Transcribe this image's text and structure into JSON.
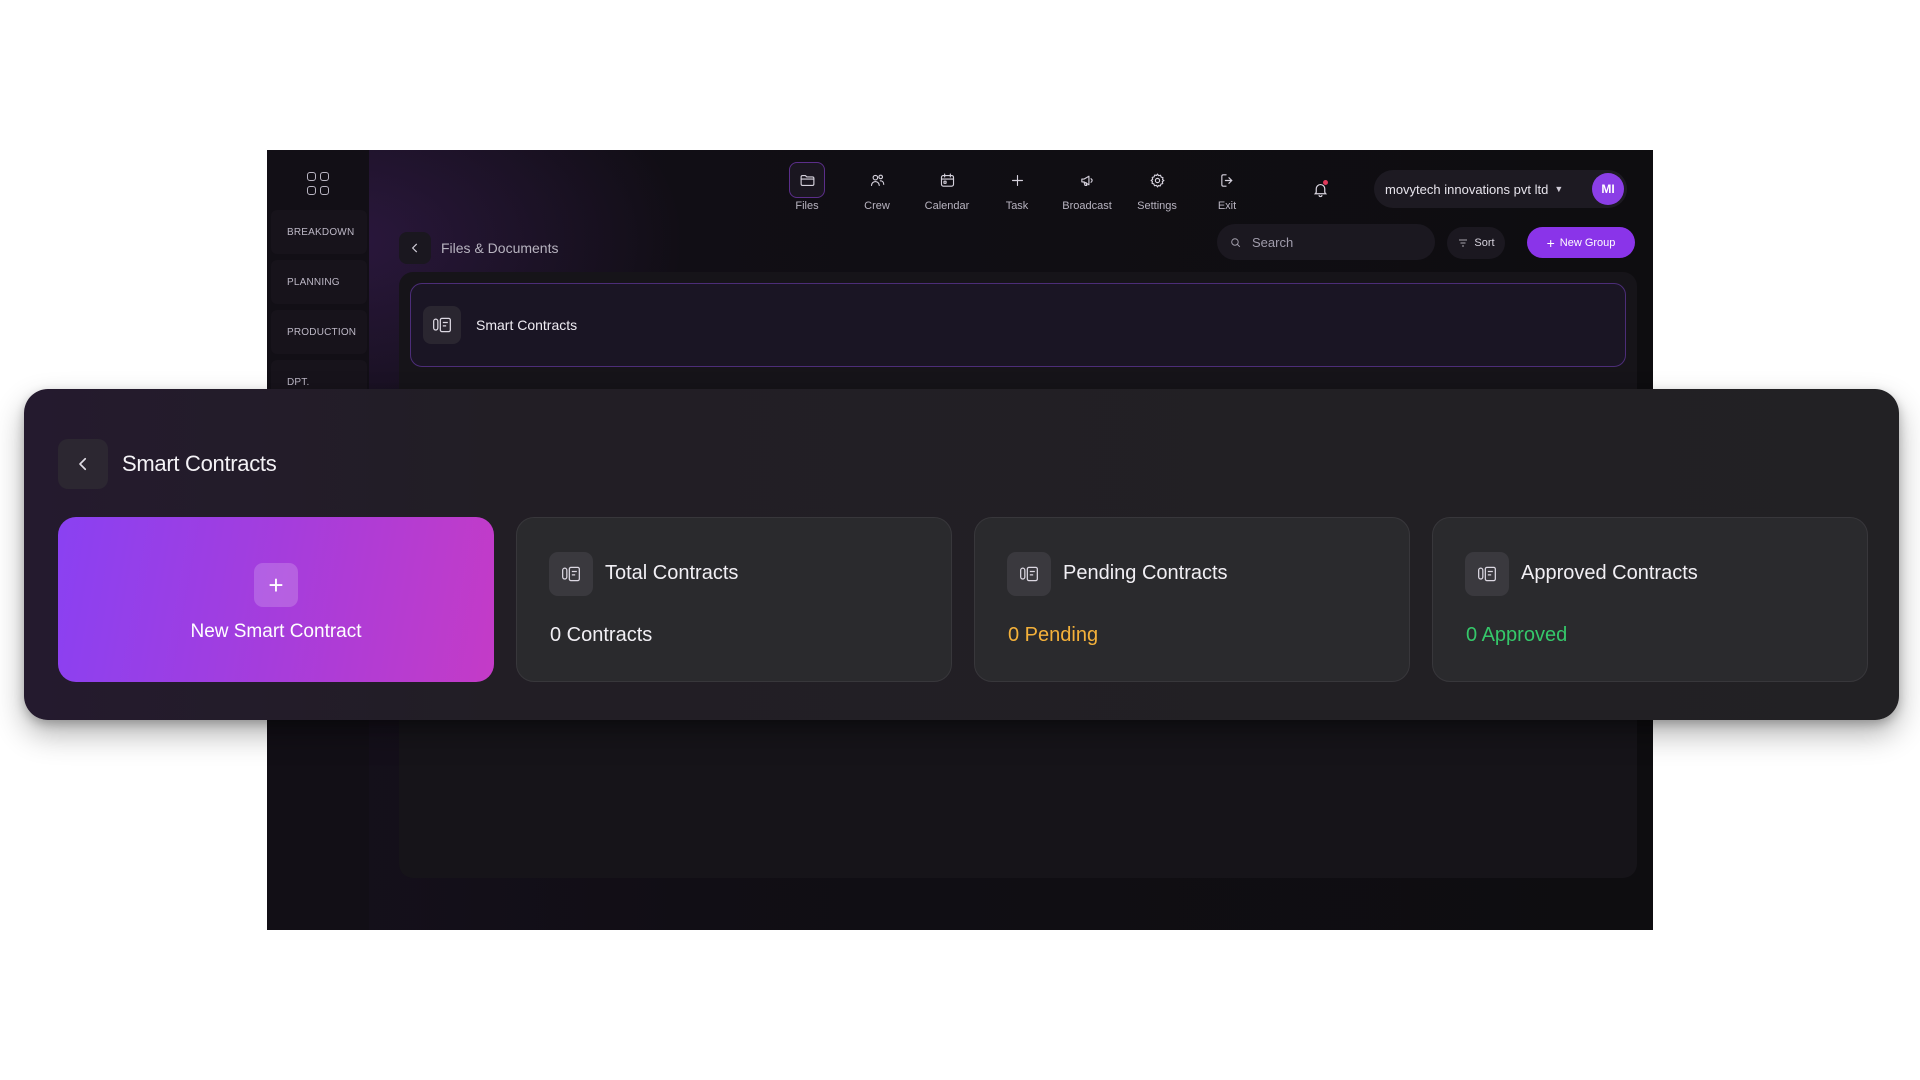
{
  "sidebar": {
    "items": [
      {
        "label": "BREAKDOWN"
      },
      {
        "label": "PLANNING"
      },
      {
        "label": "PRODUCTION"
      },
      {
        "label": "DPT."
      }
    ]
  },
  "topnav": {
    "items": [
      {
        "label": "Files",
        "icon": "folder-icon",
        "active": true
      },
      {
        "label": "Crew",
        "icon": "users-icon"
      },
      {
        "label": "Calendar",
        "icon": "calendar-icon"
      },
      {
        "label": "Task",
        "icon": "plus-icon"
      },
      {
        "label": "Broadcast",
        "icon": "megaphone-icon"
      },
      {
        "label": "Settings",
        "icon": "gear-icon"
      },
      {
        "label": "Exit",
        "icon": "exit-icon"
      }
    ]
  },
  "header": {
    "company": "movytech innovations pvt ltd",
    "avatar_initials": "MI"
  },
  "breadcrumb": {
    "label": "Files & Documents"
  },
  "toolbar": {
    "search_placeholder": "Search",
    "sort_label": "Sort",
    "new_group_label": "New Group"
  },
  "folder": {
    "label": "Smart Contracts"
  },
  "overlay": {
    "title": "Smart Contracts",
    "new_contract_label": "New Smart Contract",
    "cards": [
      {
        "title": "Total Contracts",
        "value": "0 Contracts",
        "value_color": "#f1eff4"
      },
      {
        "title": "Pending Contracts",
        "value": "0 Pending",
        "value_color": "#f4b13a"
      },
      {
        "title": "Approved Contracts",
        "value": "0 Approved",
        "value_color": "#35c86a"
      }
    ]
  },
  "colors": {
    "accent": "#8a34e9",
    "pending": "#f4b13a",
    "approved": "#35c86a"
  }
}
